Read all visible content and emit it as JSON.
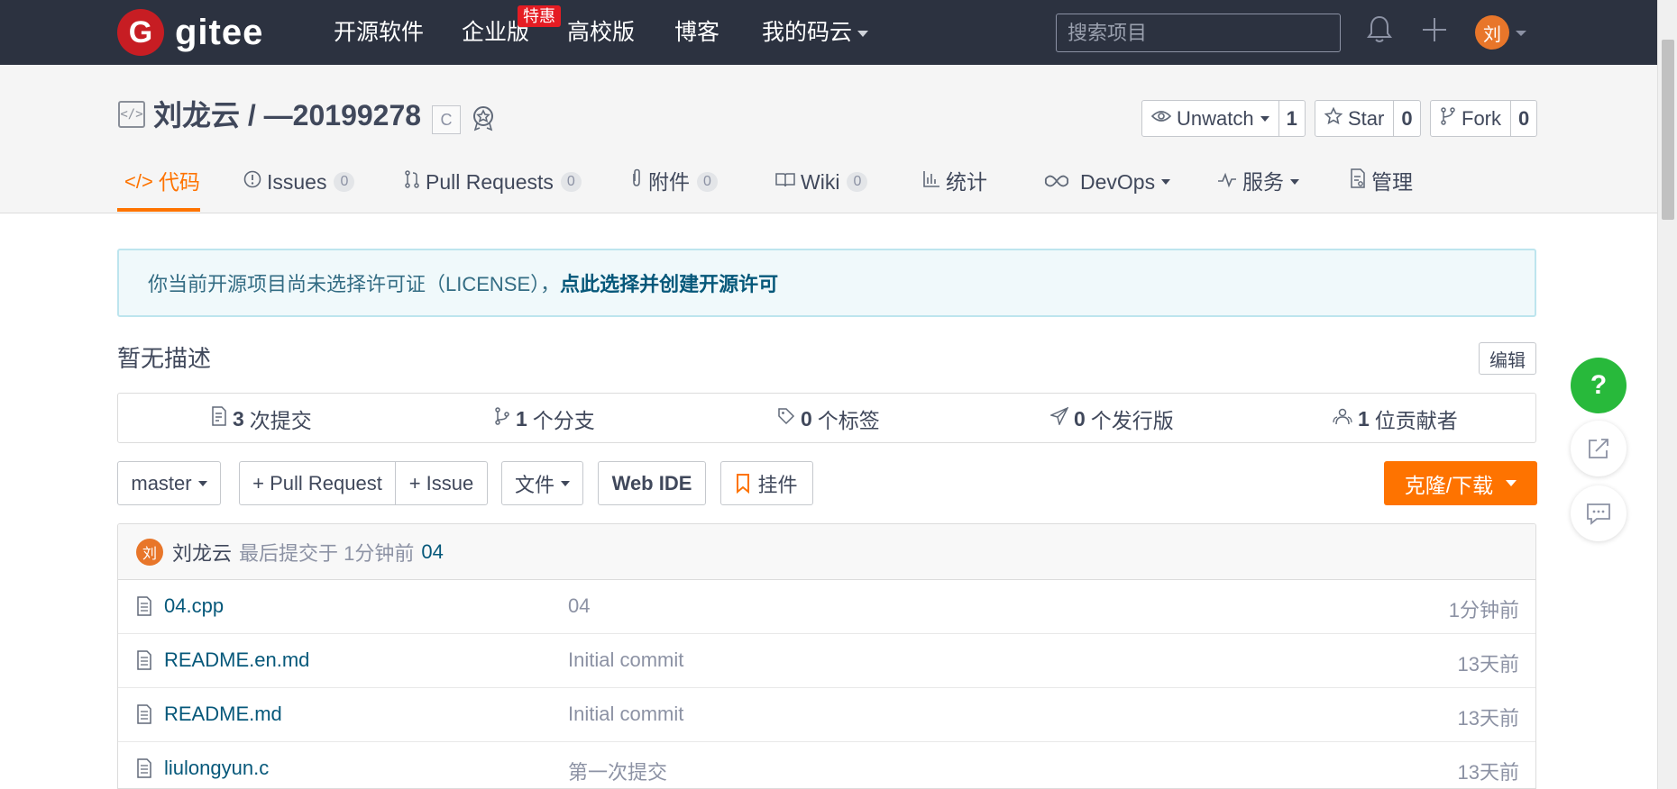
{
  "nav": {
    "logo_mark": "G",
    "logo_text": "gitee",
    "items": [
      "开源软件",
      "企业版",
      "高校版",
      "博客",
      "我的码云"
    ],
    "badge": "特惠",
    "search_placeholder": "搜索项目",
    "bell_icon": "bell-icon",
    "plus_icon": "plus-icon",
    "avatar": "刘"
  },
  "repo": {
    "title": "刘龙云 / —20199278",
    "lang_badge": "C",
    "watch": {
      "label": "Unwatch",
      "count": "1"
    },
    "star": {
      "label": "Star",
      "count": "0"
    },
    "fork": {
      "label": "Fork",
      "count": "0"
    }
  },
  "tabs": [
    {
      "label": "代码",
      "count": null
    },
    {
      "label": "Issues",
      "count": "0"
    },
    {
      "label": "Pull Requests",
      "count": "0"
    },
    {
      "label": "附件",
      "count": "0"
    },
    {
      "label": "Wiki",
      "count": "0"
    },
    {
      "label": "统计",
      "count": null
    },
    {
      "label": "DevOps",
      "count": null
    },
    {
      "label": "服务",
      "count": null
    },
    {
      "label": "管理",
      "count": null
    }
  ],
  "notice": {
    "text": "你当前开源项目尚未选择许可证（LICENSE），",
    "link": "点此选择并创建开源许可"
  },
  "description": "暂无描述",
  "edit_label": "编辑",
  "stats": [
    {
      "count": "3",
      "label": "次提交"
    },
    {
      "count": "1",
      "label": "个分支"
    },
    {
      "count": "0",
      "label": "个标签"
    },
    {
      "count": "0",
      "label": "个发行版"
    },
    {
      "count": "1",
      "label": "位贡献者"
    }
  ],
  "toolbar": {
    "branch": "master",
    "pull_request": "+ Pull Request",
    "issue": "+ Issue",
    "files": "文件",
    "web_ide": "Web IDE",
    "widget": "挂件",
    "clone": "克隆/下载"
  },
  "last_commit": {
    "avatar": "刘",
    "author": "刘龙云",
    "text": "最后提交于 1分钟前",
    "message": "04"
  },
  "files": [
    {
      "name": "04.cpp",
      "commit": "04",
      "time": "1分钟前"
    },
    {
      "name": "README.en.md",
      "commit": "Initial commit",
      "time": "13天前"
    },
    {
      "name": "README.md",
      "commit": "Initial commit",
      "time": "13天前"
    },
    {
      "name": "liulongyun.c",
      "commit": "第一次提交",
      "time": "13天前"
    }
  ],
  "float_help": "?",
  "colors": {
    "accent": "#fe7300",
    "nav_bg": "#2c3240",
    "link": "#06587a",
    "help": "#28b93b"
  }
}
